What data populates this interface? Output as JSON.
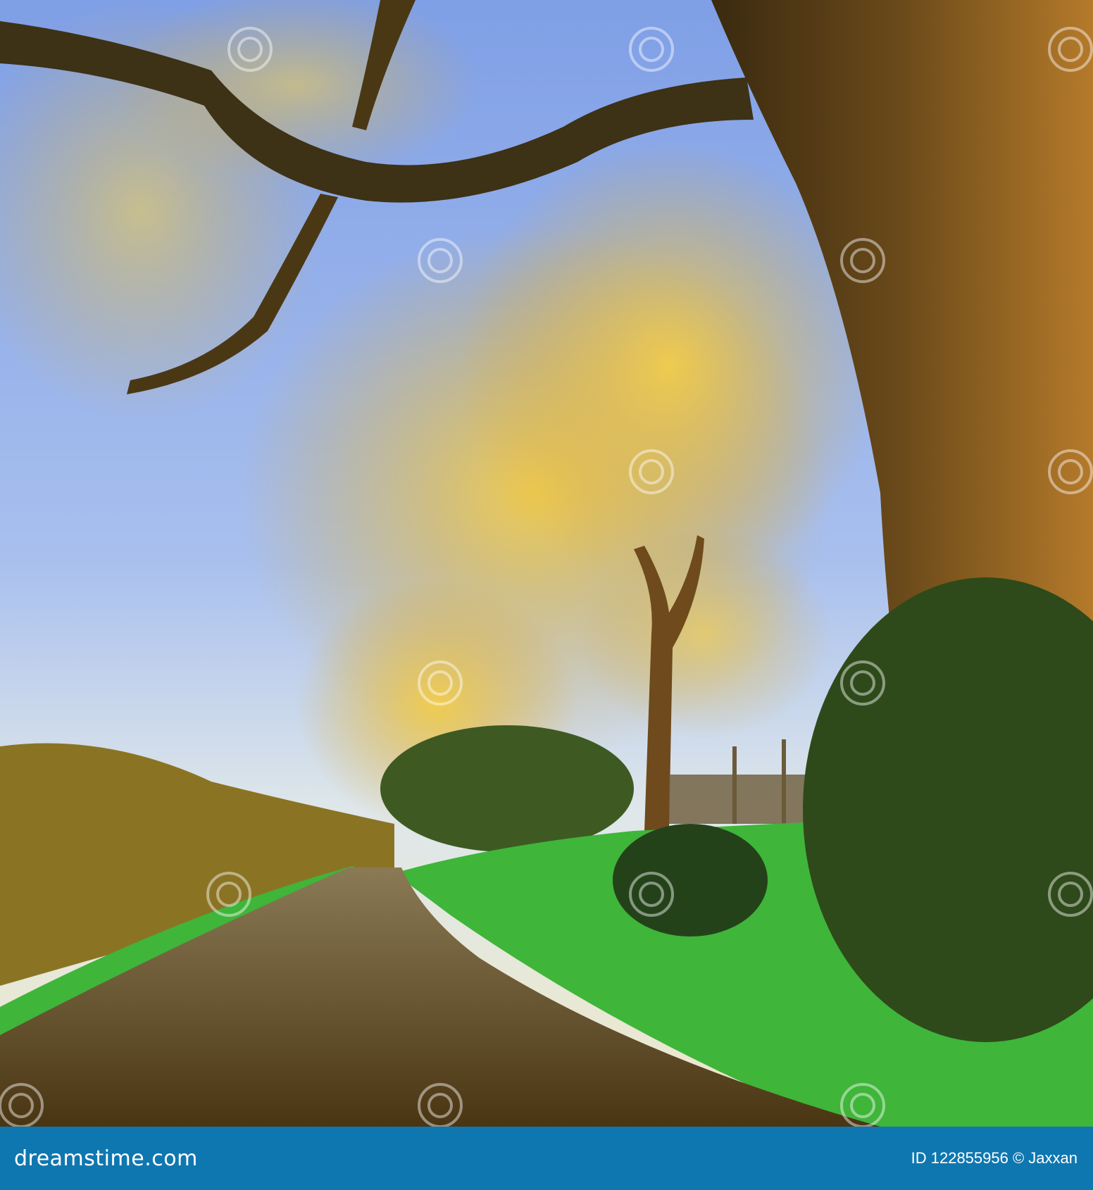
{
  "photo": {
    "subject": "tree-lined dirt path at golden hour",
    "watermark": "dreamstime"
  },
  "footer": {
    "logo": "dreamstime.com",
    "credit": "ID 122855956 © Jaxxan"
  },
  "colors": {
    "footer_bg": "#0f77b0",
    "sky": "#8fb0ea",
    "foliage": "#d9a832",
    "grass": "#3fb53a",
    "path": "#5a4418"
  }
}
